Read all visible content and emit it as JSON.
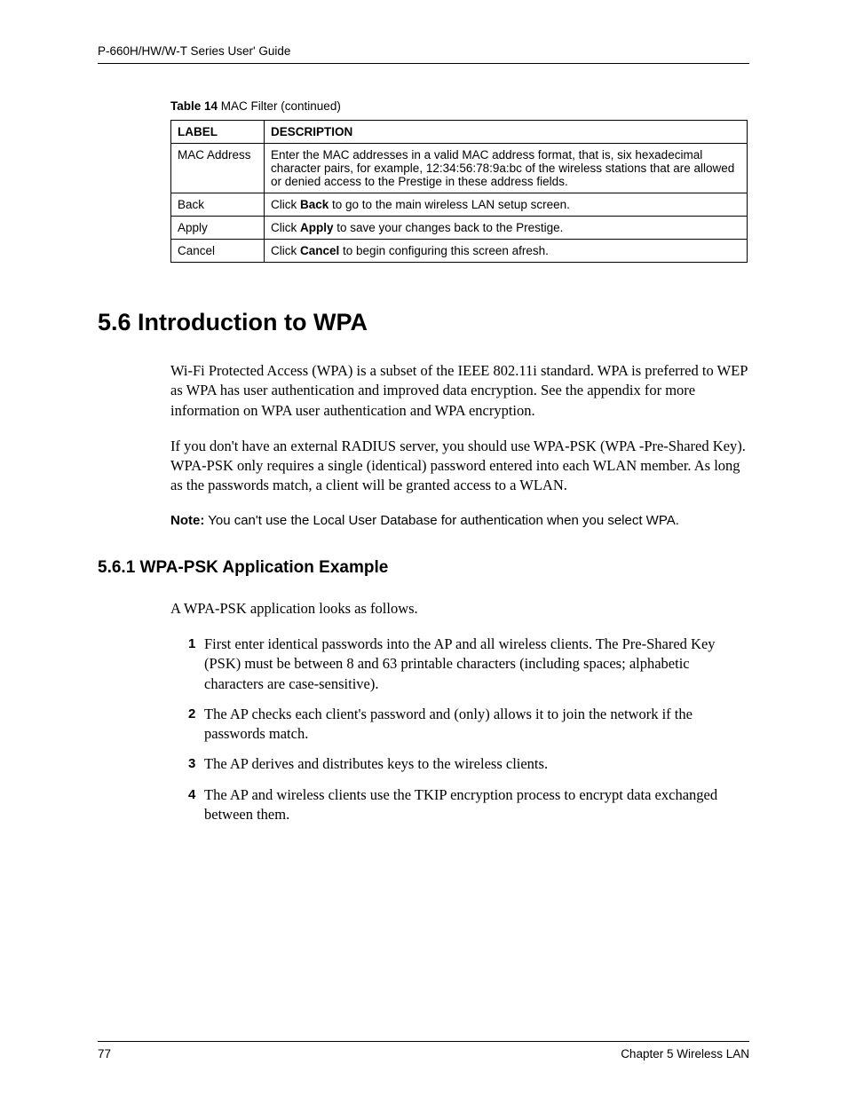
{
  "header": {
    "guide_title": "P-660H/HW/W-T Series User' Guide"
  },
  "table": {
    "caption_label": "Table 14",
    "caption_text": "   MAC Filter (continued)",
    "headers": {
      "label": "LABEL",
      "description": "DESCRIPTION"
    },
    "rows": [
      {
        "label": "MAC Address",
        "desc": "Enter the MAC addresses in a valid MAC address format, that is, six hexadecimal character pairs, for example, 12:34:56:78:9a:bc of the wireless stations that are allowed or denied access to the Prestige in these address fields."
      },
      {
        "label": "Back",
        "desc_pre": "Click ",
        "desc_bold": "Back",
        "desc_post": " to go to the main wireless LAN setup screen."
      },
      {
        "label": "Apply",
        "desc_pre": "Click ",
        "desc_bold": "Apply",
        "desc_post": " to save your changes back to the Prestige."
      },
      {
        "label": "Cancel",
        "desc_pre": "Click ",
        "desc_bold": "Cancel",
        "desc_post": " to begin configuring this screen afresh."
      }
    ]
  },
  "section": {
    "heading": "5.6  Introduction to WPA",
    "para1": "Wi-Fi Protected Access (WPA) is a subset of the IEEE 802.11i standard. WPA is preferred to WEP as WPA has user authentication and improved data encryption. See the appendix for more information on WPA user authentication and WPA encryption.",
    "para2": "If you don't have an external RADIUS server, you should use WPA-PSK (WPA -Pre-Shared Key). WPA-PSK only requires a single (identical) password entered into each WLAN member. As long as the passwords match, a client will be granted access to a WLAN.",
    "note_label": "Note:",
    "note_text": " You can't use the Local User Database for authentication when you select WPA."
  },
  "subsection": {
    "heading": "5.6.1  WPA-PSK Application Example",
    "intro": "A WPA-PSK application looks as follows.",
    "items": [
      {
        "num": "1",
        "text": "First enter identical passwords into the AP and all wireless clients. The Pre-Shared Key (PSK) must be between 8 and 63 printable characters (including spaces; alphabetic characters are case-sensitive)."
      },
      {
        "num": "2",
        "text": "The AP checks each client's password and (only) allows it to join the network if the passwords match."
      },
      {
        "num": "3",
        "text": "The AP derives and distributes keys to the wireless clients."
      },
      {
        "num": "4",
        "text": "The AP and wireless clients use the TKIP encryption process to encrypt data exchanged between them."
      }
    ]
  },
  "footer": {
    "page": "77",
    "chapter": "Chapter 5 Wireless LAN"
  }
}
